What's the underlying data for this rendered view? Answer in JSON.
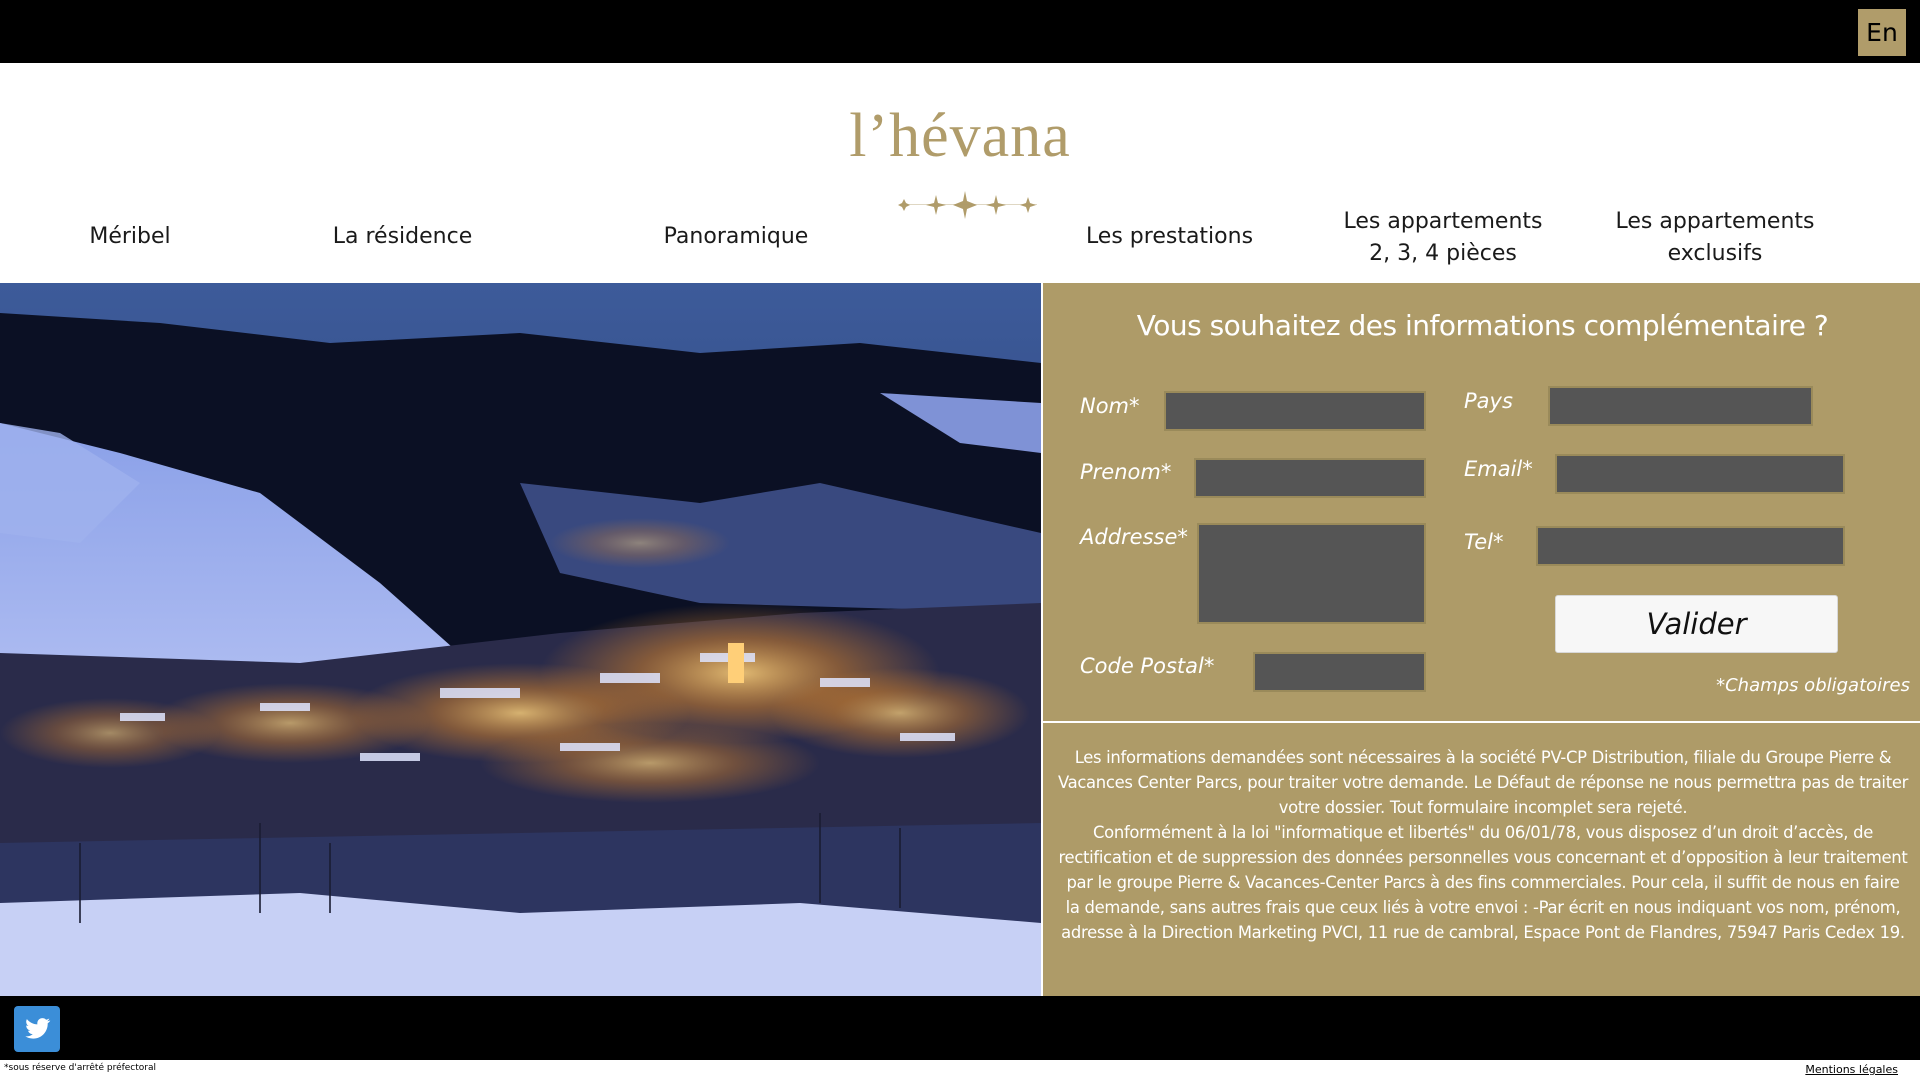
{
  "topbar": {
    "lang_label": "En"
  },
  "brand": {
    "logo_text": "l’hévana"
  },
  "nav": {
    "items": [
      {
        "label": "Méribel"
      },
      {
        "label": "La résidence"
      },
      {
        "label": "Panoramique"
      },
      {
        "label": "Les prestations"
      },
      {
        "line1": "Les appartements",
        "line2": "2, 3, 4 pièces"
      },
      {
        "line1": "Les appartements",
        "line2": "exclusifs"
      }
    ]
  },
  "form": {
    "title": "Vous souhaitez des informations complémentaire ?",
    "labels": {
      "nom": "Nom*",
      "prenom": "Prenom*",
      "addresse": "Addresse*",
      "code_postal": "Code Postal*",
      "pays": "Pays",
      "email": "Email*",
      "tel": "Tel*"
    },
    "values": {
      "nom": "",
      "prenom": "",
      "addresse": "",
      "code_postal": "",
      "pays": "",
      "email": "",
      "tel": ""
    },
    "submit_label": "Valider",
    "required_note": "*Champs obligatoires"
  },
  "legal": {
    "paragraph1": "Les informations demandées sont nécessaires à la société PV-CP Distribution, filiale du Groupe Pierre & Vacances Center Parcs, pour traiter votre demande. Le Défaut de réponse ne nous permettra pas de traiter votre dossier. Tout formulaire incomplet sera rejeté.",
    "paragraph2": "Conformément à la loi \"informatique et libertés\" du 06/01/78, vous disposez d’un droit d’accès, de rectification et de suppression des données personnelles vous concernant et d’opposition à leur traitement par le groupe Pierre & Vacances-Center Parcs à des fins commerciales. Pour cela, il suffit de nous en faire la demande, sans autres frais que ceux liés à votre envoi : -Par écrit en nous indiquant vos nom, prénom, adresse à la Direction Marketing PVCI, 11 rue de cambral, Espace Pont de Flandres, 75947 Paris Cedex 19."
  },
  "footer": {
    "left_note": "*sous réserve d'arrêté préfectoral",
    "right_link": "Mentions légales"
  },
  "colors": {
    "gold": "#ae9b68",
    "input_bg": "#555555",
    "bar": "#000000"
  },
  "icons": {
    "social": "twitter-icon",
    "logo_decoration": "stars-icon"
  }
}
